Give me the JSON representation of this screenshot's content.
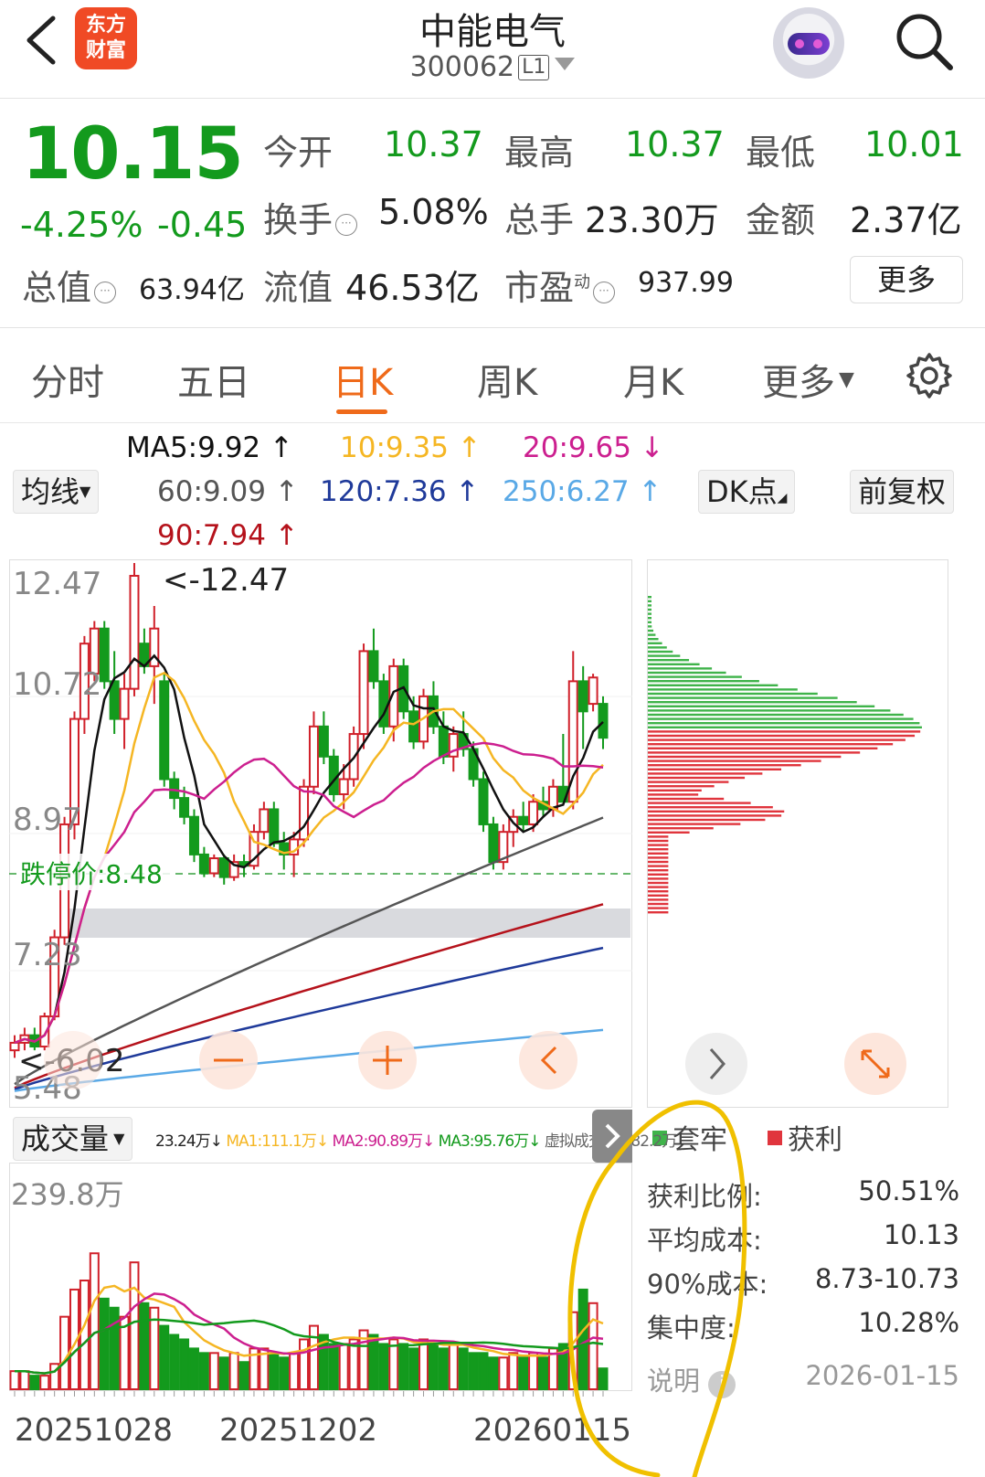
{
  "header": {
    "logo_line1": "东方",
    "logo_line2": "财富",
    "title": "中能电气",
    "code": "300062",
    "level": "L1"
  },
  "quote": {
    "price": "10.15",
    "change_pct": "-4.25%",
    "change_amt": "-0.45",
    "open_label": "今开",
    "open": "10.37",
    "high_label": "最高",
    "high": "10.37",
    "low_label": "最低",
    "low": "10.01",
    "turnover_label": "换手",
    "turnover": "5.08%",
    "volume_label": "总手",
    "volume": "23.30万",
    "amount_label": "金额",
    "amount": "2.37亿",
    "mktcap_label": "总值",
    "mktcap": "63.94亿",
    "float_label": "流值",
    "float_cap": "46.53亿",
    "pe_label": "市盈",
    "pe_sup": "动",
    "pe": "937.99",
    "more_label": "更多"
  },
  "tabs": [
    "分时",
    "五日",
    "日K",
    "周K",
    "月K",
    "更多"
  ],
  "active_tab": "日K",
  "ma_legend": {
    "ma5": "MA5:9.92",
    "ma10": "10:9.35",
    "ma20": "20:9.65",
    "ma60": "60:9.09",
    "ma120": "120:7.36",
    "ma250": "250:6.27",
    "ma90": "90:7.94",
    "avg_btn": "均线",
    "dk_btn": "DK点",
    "fq_btn": "前复权"
  },
  "colors": {
    "up": "#d0202a",
    "down": "#139a1d",
    "ma5": "#111111",
    "ma10": "#f5b623",
    "ma20": "#cc1f8f",
    "ma60": "#555555",
    "ma90": "#b5121b",
    "ma120": "#1f3a9a",
    "ma250": "#5aa9e6",
    "accent": "#ef6a1a"
  },
  "kchart": {
    "y_labels": [
      "12.47",
      "10.72",
      "8.97",
      "7.23",
      "5.48"
    ],
    "max_mark": "<-12.47",
    "min_mark": "<-6.02",
    "limit_label": "跌停价:8.48"
  },
  "chip": {
    "legend_trapped": "套牢",
    "legend_profit": "获利",
    "profit_ratio_label": "获利比例:",
    "profit_ratio": "50.51%",
    "avg_cost_label": "平均成本:",
    "avg_cost": "10.13",
    "cost90_label": "90%成本:",
    "cost90": "8.73-10.73",
    "concentration_label": "集中度:",
    "concentration": "10.28%",
    "note_label": "说明",
    "date": "2026-01-15"
  },
  "volume": {
    "selector": "成交量",
    "vol": "23.24万↓",
    "ma1": "MA1:111.1万↓",
    "ma2": "MA2:90.89万↓",
    "ma3": "MA3:95.76万↓",
    "virtual": "虚拟成交量:182.2万",
    "y_top": "239.8万",
    "dates": [
      "20251028",
      "20251202",
      "20260115"
    ]
  },
  "chart_data": {
    "type": "candlestick",
    "y_range": [
      5.48,
      12.47
    ],
    "candles": [
      [
        6.0,
        6.2,
        5.9,
        6.1
      ],
      [
        6.1,
        6.3,
        6.0,
        6.2
      ],
      [
        6.2,
        6.3,
        6.0,
        6.05
      ],
      [
        6.05,
        6.5,
        6.0,
        6.45
      ],
      [
        6.45,
        7.6,
        6.4,
        7.5
      ],
      [
        7.5,
        9.1,
        7.4,
        9.0
      ],
      [
        9.0,
        10.5,
        8.8,
        10.4
      ],
      [
        10.4,
        11.5,
        10.2,
        11.4
      ],
      [
        11.0,
        11.7,
        10.9,
        11.6
      ],
      [
        11.6,
        11.7,
        10.8,
        10.9
      ],
      [
        10.9,
        11.3,
        10.2,
        10.4
      ],
      [
        10.4,
        11.0,
        10.0,
        10.8
      ],
      [
        10.8,
        12.47,
        10.7,
        12.3
      ],
      [
        11.4,
        11.6,
        11.0,
        11.1
      ],
      [
        11.1,
        11.9,
        10.6,
        11.6
      ],
      [
        10.9,
        11.0,
        9.5,
        9.6
      ],
      [
        9.6,
        9.7,
        9.2,
        9.35
      ],
      [
        9.35,
        9.5,
        9.0,
        9.1
      ],
      [
        9.1,
        9.2,
        8.5,
        8.6
      ],
      [
        8.6,
        8.7,
        8.3,
        8.35
      ],
      [
        8.35,
        8.6,
        8.3,
        8.55
      ],
      [
        8.55,
        8.6,
        8.2,
        8.3
      ],
      [
        8.3,
        8.6,
        8.25,
        8.5
      ],
      [
        8.5,
        8.6,
        8.3,
        8.45
      ],
      [
        8.45,
        9.0,
        8.4,
        8.9
      ],
      [
        8.9,
        9.3,
        8.8,
        9.2
      ],
      [
        9.2,
        9.3,
        8.7,
        8.75
      ],
      [
        8.75,
        8.9,
        8.4,
        8.6
      ],
      [
        8.6,
        8.9,
        8.3,
        8.8
      ],
      [
        8.8,
        9.6,
        8.7,
        9.5
      ],
      [
        9.5,
        10.5,
        9.4,
        10.3
      ],
      [
        10.3,
        10.5,
        9.8,
        9.9
      ],
      [
        9.9,
        10.0,
        9.3,
        9.4
      ],
      [
        9.4,
        9.8,
        9.2,
        9.6
      ],
      [
        9.6,
        10.3,
        9.5,
        10.2
      ],
      [
        10.2,
        11.4,
        10.0,
        11.3
      ],
      [
        11.3,
        11.6,
        10.8,
        10.9
      ],
      [
        10.9,
        11.0,
        10.2,
        10.3
      ],
      [
        10.3,
        11.2,
        10.1,
        11.1
      ],
      [
        11.1,
        11.2,
        10.4,
        10.5
      ],
      [
        10.5,
        10.7,
        10.0,
        10.1
      ],
      [
        10.1,
        10.8,
        10.0,
        10.7
      ],
      [
        10.7,
        10.9,
        10.2,
        10.3
      ],
      [
        10.3,
        10.5,
        9.8,
        9.9
      ],
      [
        9.9,
        10.3,
        9.7,
        10.2
      ],
      [
        10.2,
        10.5,
        9.9,
        10.0
      ],
      [
        10.0,
        10.1,
        9.5,
        9.6
      ],
      [
        9.6,
        9.7,
        8.9,
        9.0
      ],
      [
        9.0,
        9.1,
        8.4,
        8.5
      ],
      [
        8.5,
        9.0,
        8.4,
        8.9
      ],
      [
        8.9,
        9.2,
        8.7,
        9.1
      ],
      [
        9.1,
        9.3,
        8.9,
        9.0
      ],
      [
        9.0,
        9.4,
        8.9,
        9.3
      ],
      [
        9.3,
        9.5,
        9.1,
        9.2
      ],
      [
        9.2,
        9.6,
        9.1,
        9.5
      ],
      [
        9.5,
        10.2,
        9.3,
        9.3
      ],
      [
        9.3,
        11.3,
        9.2,
        10.9
      ],
      [
        10.9,
        11.1,
        10.0,
        10.5
      ],
      [
        10.6,
        11.0,
        10.5,
        10.95
      ],
      [
        10.6,
        10.7,
        10.0,
        10.15
      ]
    ],
    "volume_series": [
      {
        "name": "成交量",
        "values": [
          20,
          20,
          15,
          15,
          28,
          80,
          110,
          120,
          150,
          100,
          90,
          80,
          140,
          95,
          90,
          70,
          60,
          55,
          45,
          40,
          40,
          35,
          40,
          30,
          45,
          45,
          40,
          35,
          40,
          55,
          70,
          60,
          50,
          50,
          55,
          65,
          60,
          50,
          55,
          50,
          45,
          55,
          50,
          45,
          50,
          45,
          40,
          40,
          35,
          35,
          40,
          35,
          40,
          35,
          45,
          50,
          85,
          110,
          95,
          23
        ]
      }
    ]
  }
}
